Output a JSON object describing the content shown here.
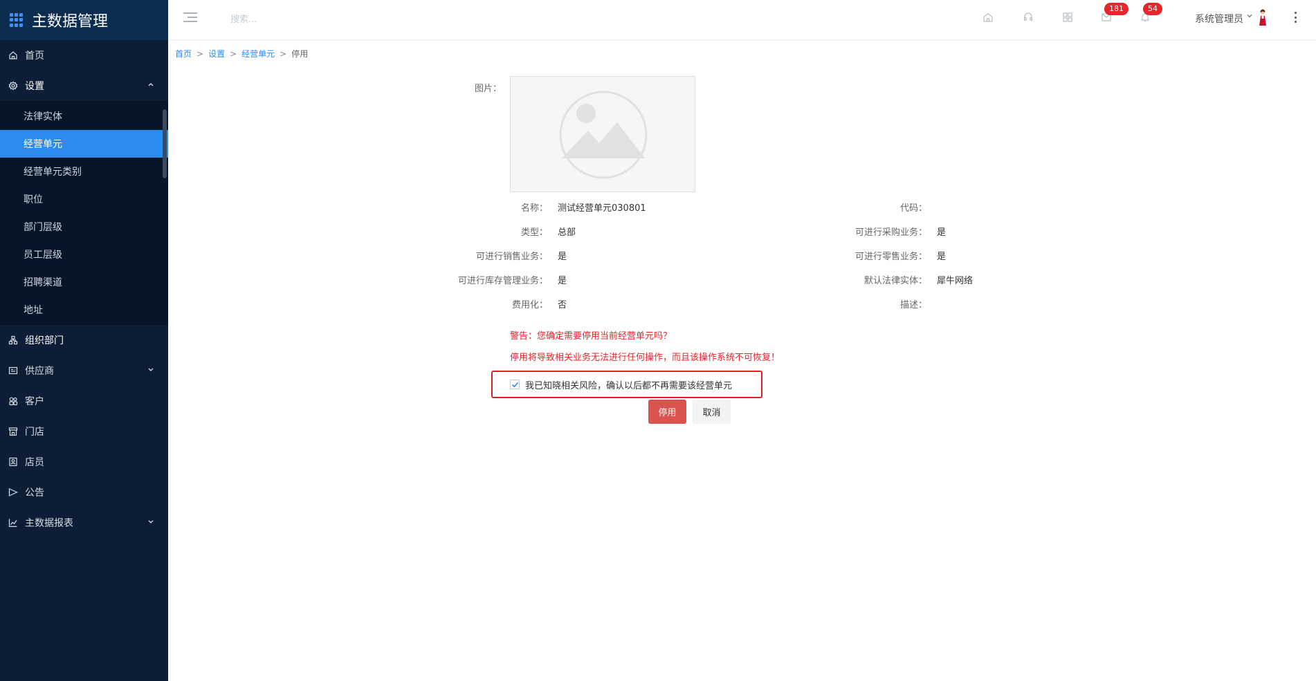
{
  "sidebar": {
    "brand": "主数据管理",
    "menu": {
      "home": "首页",
      "settings": "设置",
      "org": "组织部门",
      "supplier": "供应商",
      "customer": "客户",
      "store": "门店",
      "clerk": "店员",
      "notice": "公告",
      "report": "主数据报表"
    },
    "submenu": [
      "法律实体",
      "经营单元",
      "经营单元类别",
      "职位",
      "部门层级",
      "员工层级",
      "招聘渠道",
      "地址"
    ]
  },
  "header": {
    "search_placeholder": "搜索...",
    "badges": {
      "messages": "181",
      "notifications": "54"
    },
    "user": "系统管理员"
  },
  "breadcrumb": {
    "home": "首页",
    "settings": "设置",
    "unit": "经营单元",
    "current": "停用",
    "sep": ">"
  },
  "form": {
    "labels": {
      "image": "图片：",
      "name": "名称：",
      "code": "代码：",
      "type": "类型：",
      "purchase": "可进行采购业务：",
      "sales": "可进行销售业务：",
      "retail": "可进行零售业务：",
      "inventory": "可进行库存管理业务：",
      "legal": "默认法律实体：",
      "expense": "费用化：",
      "desc": "描述："
    },
    "values": {
      "name": "测试经营单元030801",
      "code": "",
      "type": "总部",
      "purchase": "是",
      "sales": "是",
      "retail": "是",
      "inventory": "是",
      "legal": "犀牛网络",
      "expense": "否",
      "desc": ""
    }
  },
  "warning": {
    "line1": "警告：您确定需要停用当前经营单元吗？",
    "line2": "停用将导致相关业务无法进行任何操作，而且该操作系统不可恢复！"
  },
  "confirm": {
    "text": "我已知晓相关风险，确认以后都不再需要该经营单元",
    "checked": true
  },
  "buttons": {
    "disable": "停用",
    "cancel": "取消"
  }
}
